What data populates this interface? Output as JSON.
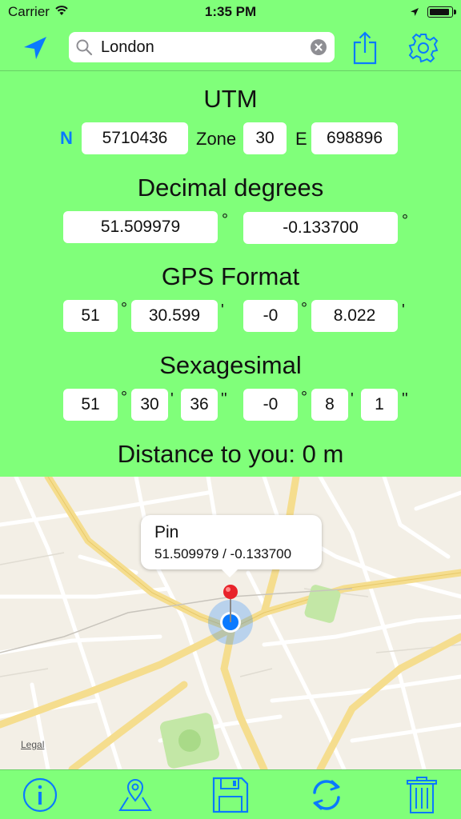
{
  "status_bar": {
    "carrier": "Carrier",
    "time": "1:35 PM"
  },
  "search": {
    "value": "London"
  },
  "utm": {
    "title": "UTM",
    "hemisphere": "N",
    "northing": "5710436",
    "zone_label": "Zone",
    "zone": "30",
    "easting_label": "E",
    "easting": "698896"
  },
  "decimal": {
    "title": "Decimal degrees",
    "lat": "51.509979",
    "lon": "-0.133700",
    "degree_symbol": "°"
  },
  "gps": {
    "title": "GPS Format",
    "lat_deg": "51",
    "lat_min": "30.599",
    "lon_deg": "-0",
    "lon_min": "8.022",
    "degree_symbol": "°",
    "minute_symbol": "'"
  },
  "sexagesimal": {
    "title": "Sexagesimal",
    "lat_deg": "51",
    "lat_min": "30",
    "lat_sec": "36",
    "lon_deg": "-0",
    "lon_min": "8",
    "lon_sec": "1",
    "degree_symbol": "°",
    "minute_symbol": "'",
    "second_symbol": "''"
  },
  "distance": {
    "text": "Distance to you: 0 m"
  },
  "map": {
    "callout_title": "Pin",
    "callout_coords": "51.509979 / -0.133700",
    "legal": "Legal"
  },
  "icons": {
    "top": [
      "location-arrow-icon",
      "search-icon",
      "clear-icon",
      "share-icon",
      "gear-icon"
    ],
    "bottom": [
      "info-icon",
      "map-pin-icon",
      "save-icon",
      "refresh-icon",
      "trash-icon"
    ]
  },
  "colors": {
    "background": "#80FF7A",
    "accent": "#0A7AFF",
    "pin": "#E8232A"
  }
}
